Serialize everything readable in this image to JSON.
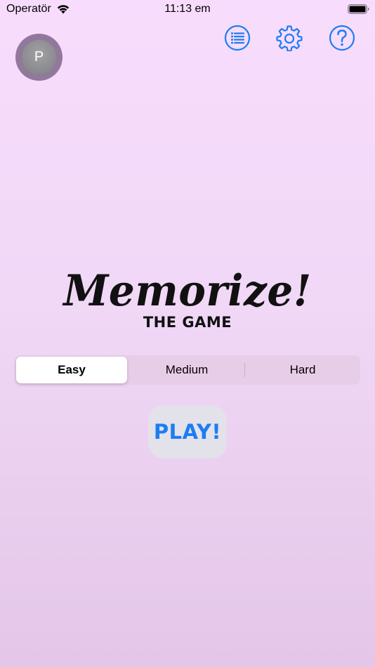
{
  "status_bar": {
    "carrier": "Operatör",
    "time": "11:13 em",
    "icons": [
      "wifi-icon",
      "battery-icon"
    ]
  },
  "toolbar": {
    "avatar_initial": "P",
    "buttons": [
      "list-icon",
      "gear-icon",
      "help-icon"
    ]
  },
  "title": {
    "main": "Memorize!",
    "sub": "THE GAME"
  },
  "difficulty": {
    "options": [
      "Easy",
      "Medium",
      "Hard"
    ],
    "selected": "Easy"
  },
  "play_button": {
    "label": "PLAY!"
  },
  "colors": {
    "accent": "#1c7df3",
    "background_top": "#f8dcfd",
    "background_bottom": "#e4c6e8",
    "avatar_ring": "#92789a",
    "play_button_bg": "#e3e1ea"
  }
}
